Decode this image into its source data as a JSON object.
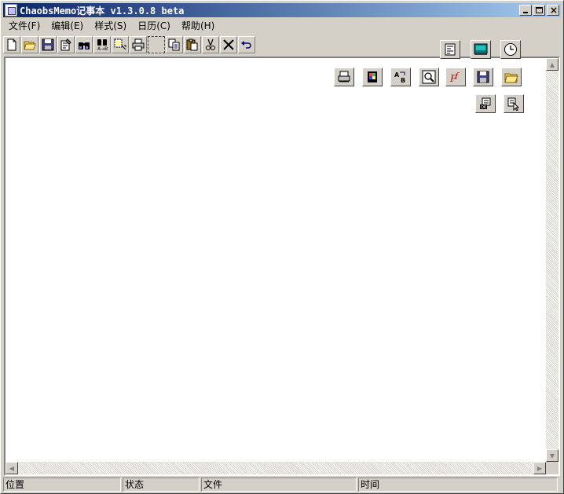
{
  "window": {
    "title": "ChaobsMemo记事本 v1.3.0.8 beta"
  },
  "menu": {
    "items": [
      {
        "label": "文件(F)"
      },
      {
        "label": "编辑(E)"
      },
      {
        "label": "样式(S)"
      },
      {
        "label": "日历(C)"
      },
      {
        "label": "帮助(H)"
      }
    ]
  },
  "toolbar": {
    "buttons": [
      {
        "icon": "new-file-icon"
      },
      {
        "icon": "open-folder-icon"
      },
      {
        "icon": "save-icon"
      },
      {
        "icon": "properties-icon"
      },
      {
        "icon": "find-icon"
      },
      {
        "icon": "replace-icon"
      },
      {
        "icon": "select-all-icon"
      },
      {
        "icon": "print-icon"
      },
      {
        "icon": "copy-icon"
      },
      {
        "icon": "paste-icon"
      },
      {
        "icon": "cut-icon"
      },
      {
        "icon": "delete-icon"
      },
      {
        "icon": "undo-icon"
      }
    ]
  },
  "floating_buttons": {
    "row1": [
      "format-icon",
      "screen-icon",
      "clock-icon"
    ],
    "row2": [
      "print-preview-icon",
      "color-palette-icon",
      "replace-ab-icon",
      "zoom-icon",
      "font-icon",
      "save-disk-icon",
      "open-icon"
    ],
    "row3": [
      "list-ok-icon",
      "pointer-icon"
    ]
  },
  "statusbar": {
    "position_label": "位置",
    "state_label": "状态",
    "file_label": "文件",
    "time_label": "时间"
  },
  "colors": {
    "title_start": "#0a246a",
    "title_end": "#a6caf0",
    "face": "#d4d0c8"
  }
}
